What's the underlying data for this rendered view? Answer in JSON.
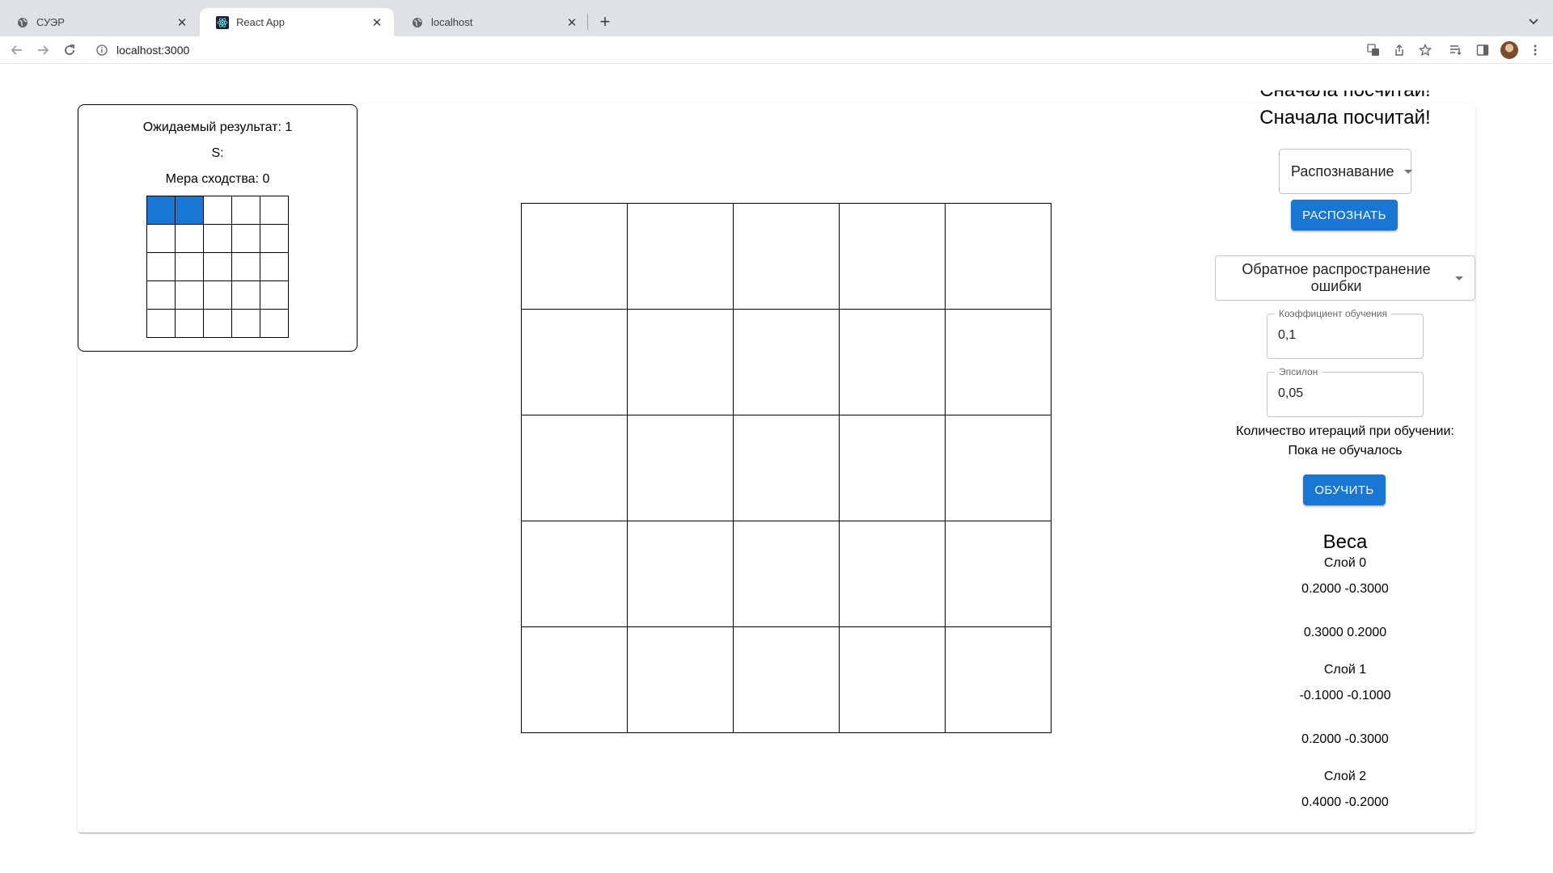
{
  "browser": {
    "tabs": [
      {
        "title": "СУЭР",
        "icon": "globe-icon",
        "active": false
      },
      {
        "title": "React App",
        "icon": "react-icon",
        "active": true
      },
      {
        "title": "localhost",
        "icon": "globe-icon",
        "active": false
      }
    ],
    "url": "localhost:3000"
  },
  "result_panel": {
    "expected": "Ожидаемый результат: 1",
    "s": "S:",
    "similarity": "Мера сходства: 0",
    "grid": [
      [
        1,
        1,
        0,
        0,
        0
      ],
      [
        0,
        0,
        0,
        0,
        0
      ],
      [
        0,
        0,
        0,
        0,
        0
      ],
      [
        0,
        0,
        0,
        0,
        0
      ],
      [
        0,
        0,
        0,
        0,
        0
      ]
    ]
  },
  "drawing_grid": {
    "rows": 5,
    "cols": 5,
    "cells": [
      [
        0,
        0,
        0,
        0,
        0
      ],
      [
        0,
        0,
        0,
        0,
        0
      ],
      [
        0,
        0,
        0,
        0,
        0
      ],
      [
        0,
        0,
        0,
        0,
        0
      ],
      [
        0,
        0,
        0,
        0,
        0
      ]
    ]
  },
  "side_panel": {
    "heading_clipped": "Сначала посчитай!",
    "heading": "Сначала посчитай!",
    "mode_select": "Распознавание",
    "recognize_button": "Распознать",
    "algorithm_select": "Обратное распространение ошибки",
    "learning_rate": {
      "label": "Коэффициент обучения",
      "value": "0,1"
    },
    "epsilon": {
      "label": "Эпсилон",
      "value": "0,05"
    },
    "iterations_label": "Количество итераций при обучении:",
    "iterations_value": "Пока не обучалось",
    "train_button": "Обучить",
    "weights": {
      "title": "Веса",
      "layers": [
        {
          "name": "Слой 0",
          "rows": [
            "0.2000 -0.3000",
            "0.3000 0.2000"
          ]
        },
        {
          "name": "Слой 1",
          "rows": [
            "-0.1000 -0.1000",
            "0.2000 -0.3000"
          ]
        },
        {
          "name": "Слой 2",
          "rows": [
            "0.4000 -0.2000"
          ]
        }
      ]
    }
  },
  "colors": {
    "accent": "#1976d2",
    "tabstrip": "#dee1e6"
  }
}
